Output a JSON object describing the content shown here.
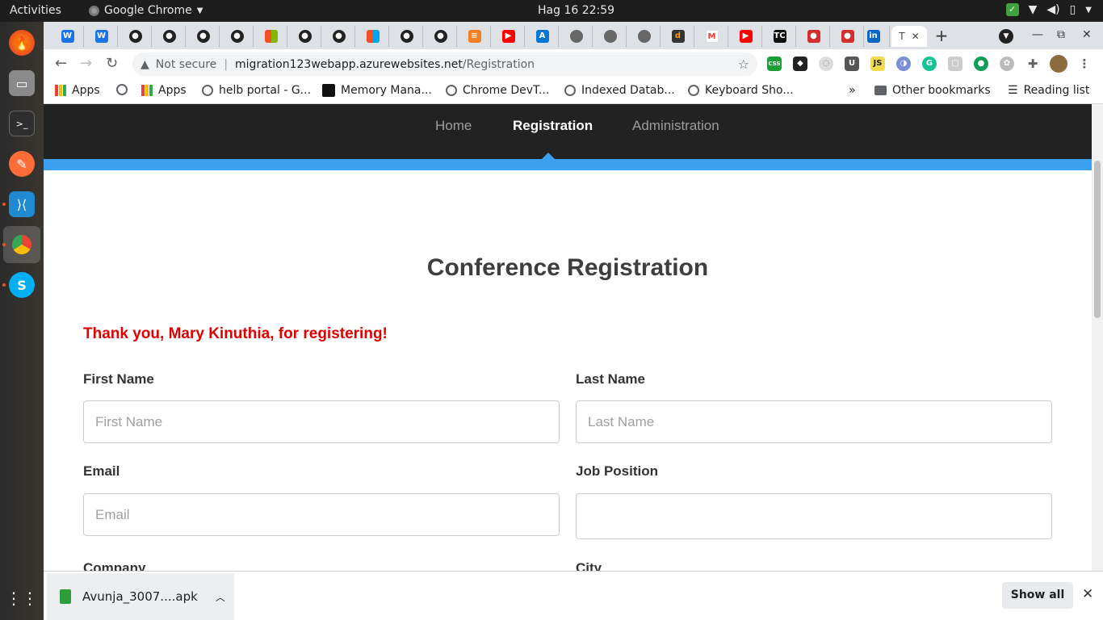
{
  "topbar": {
    "activities": "Activities",
    "app_name": "Google Chrome",
    "clock": "Hag 16  22:59"
  },
  "browser": {
    "active_tab_title": "T",
    "url": {
      "security": "Not secure",
      "host": "migration123webapp.azurewebsites.net",
      "path": "/Registration"
    },
    "bookmarks": [
      "Apps",
      "Apps",
      "helb portal - G...",
      "Memory Mana...",
      "Chrome DevT...",
      "Indexed Datab...",
      "Keyboard Sho..."
    ],
    "other_bookmarks": "Other bookmarks",
    "reading_list": "Reading list"
  },
  "site": {
    "nav": [
      "Home",
      "Registration",
      "Administration"
    ],
    "active_nav": "Registration",
    "heading": "Conference Registration",
    "thanks": "Thank you, Mary Kinuthia, for registering!",
    "form": {
      "first_name_label": "First Name",
      "first_name_placeholder": "First Name",
      "last_name_label": "Last Name",
      "last_name_placeholder": "Last Name",
      "email_label": "Email",
      "email_placeholder": "Email",
      "job_label": "Job Position",
      "company_label": "Company",
      "city_label": "City"
    }
  },
  "download": {
    "file": "Avunja_3007....apk",
    "show_all": "Show all"
  }
}
